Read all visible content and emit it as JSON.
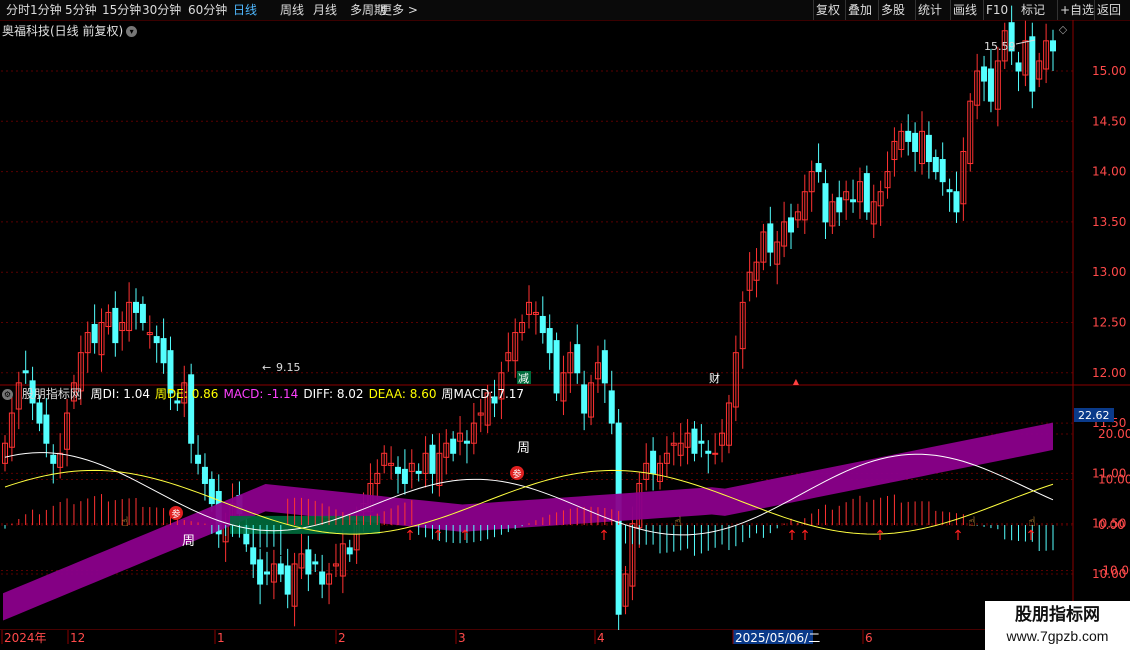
{
  "toolbar": {
    "left_items": [
      "分时",
      "1分钟",
      "5分钟",
      "15分钟",
      "30分钟",
      "60分钟",
      "日线",
      "周线",
      "月线",
      "多周期",
      "更多 >"
    ],
    "active": "日线",
    "right_items": [
      "复权",
      "叠加",
      "多股",
      "统计",
      "画线",
      "F10",
      "+自选",
      "返回"
    ],
    "mark_label": "标记"
  },
  "stock_title": "奥福科技(日线 前复权)",
  "price_axis": [
    "15.00",
    "14.50",
    "14.00",
    "13.50",
    "13.00",
    "12.50",
    "12.00",
    "11.50",
    "11.00",
    "10.50",
    "10.00"
  ],
  "price_labels": {
    "high": "15.59",
    "low": "9.15"
  },
  "event_markers": [
    "减",
    "财"
  ],
  "indicator": {
    "name": "股朋指标网",
    "fields": [
      {
        "text": "周DI: 1.04",
        "color": "#ffffff"
      },
      {
        "text": "周DE: 0.86",
        "color": "#ffff00"
      },
      {
        "text": "MACD: -1.14",
        "color": "#ff40ff"
      },
      {
        "text": "DIFF: 8.02",
        "color": "#ffffff"
      },
      {
        "text": "DEAA: 8.60",
        "color": "#ffff00"
      },
      {
        "text": "周MACD: 7.17",
        "color": "#ffffff"
      }
    ],
    "current_value": "22.62",
    "axis": [
      "20.00",
      "10.00",
      "0.00",
      "-10.00"
    ],
    "labels": {
      "zhou": "周",
      "can": "参"
    }
  },
  "date_axis": [
    "2024年",
    "12",
    "1",
    "2",
    "3",
    "4",
    "2025/05/06/二",
    "6"
  ],
  "watermark": {
    "line1": "股朋指标网",
    "line2": "www.7gpzb.com"
  },
  "colors": {
    "up": "#ff3232",
    "down": "#54ffff",
    "active": "#4fb8ff",
    "purple": "#8b008b",
    "green": "#006b3c",
    "grid": "#5a0000"
  }
}
